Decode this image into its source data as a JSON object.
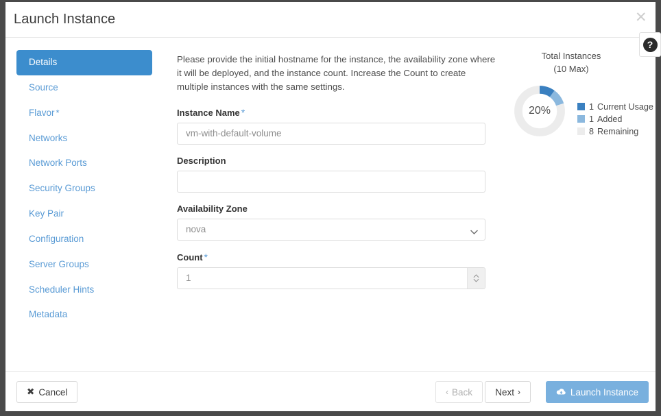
{
  "modal": {
    "title": "Launch Instance",
    "close_label": "✕",
    "help_label": "?"
  },
  "wizard_nav": {
    "items": [
      {
        "label": "Details",
        "active": true,
        "required": false
      },
      {
        "label": "Source",
        "active": false,
        "required": false
      },
      {
        "label": "Flavor",
        "active": false,
        "required": true
      },
      {
        "label": "Networks",
        "active": false,
        "required": false
      },
      {
        "label": "Network Ports",
        "active": false,
        "required": false
      },
      {
        "label": "Security Groups",
        "active": false,
        "required": false
      },
      {
        "label": "Key Pair",
        "active": false,
        "required": false
      },
      {
        "label": "Configuration",
        "active": false,
        "required": false
      },
      {
        "label": "Server Groups",
        "active": false,
        "required": false
      },
      {
        "label": "Scheduler Hints",
        "active": false,
        "required": false
      },
      {
        "label": "Metadata",
        "active": false,
        "required": false
      }
    ],
    "required_marker": "*"
  },
  "details": {
    "description": "Please provide the initial hostname for the instance, the availability zone where it will be deployed, and the instance count. Increase the Count to create multiple instances with the same settings.",
    "instance_name": {
      "label": "Instance Name",
      "required_marker": "*",
      "value": "vm-with-default-volume",
      "placeholder": "vm-with-default-volume"
    },
    "description_field": {
      "label": "Description",
      "value": "",
      "placeholder": ""
    },
    "availability_zone": {
      "label": "Availability Zone",
      "value": "nova",
      "options": [
        "nova"
      ]
    },
    "count": {
      "label": "Count",
      "required_marker": "*",
      "value": "1",
      "placeholder": "1"
    }
  },
  "quota": {
    "title_line1": "Total Instances",
    "title_line2": "(10 Max)",
    "center_label": "20%"
  },
  "chart_data": {
    "type": "pie",
    "title": "Total Instances (10 Max)",
    "subtitle": "",
    "center_label": "20%",
    "max": 10,
    "donut": true,
    "legend_position": "right",
    "categories": [
      "Current Usage",
      "Added",
      "Remaining"
    ],
    "values": [
      1,
      1,
      8
    ],
    "percentages": [
      10,
      10,
      80
    ],
    "colors": [
      "#3a80c0",
      "#8bb8de",
      "#ececec"
    ],
    "legend": [
      {
        "value": "1",
        "label": "Current Usage",
        "color": "#3a80c0"
      },
      {
        "value": "1",
        "label": "Added",
        "color": "#8bb8de"
      },
      {
        "value": "8",
        "label": "Remaining",
        "color": "#ececec"
      }
    ]
  },
  "footer": {
    "cancel_label": "Cancel",
    "cancel_icon": "✖",
    "back_label": "Back",
    "back_chevron": "‹",
    "next_label": "Next",
    "next_chevron": "›",
    "launch_label": "Launch Instance"
  },
  "colors": {
    "accent": "#3c8dcd",
    "link": "#5a9bd5",
    "primary_button": "#79b0de",
    "usage": "#3a80c0",
    "added": "#8bb8de",
    "remaining": "#ececec"
  }
}
